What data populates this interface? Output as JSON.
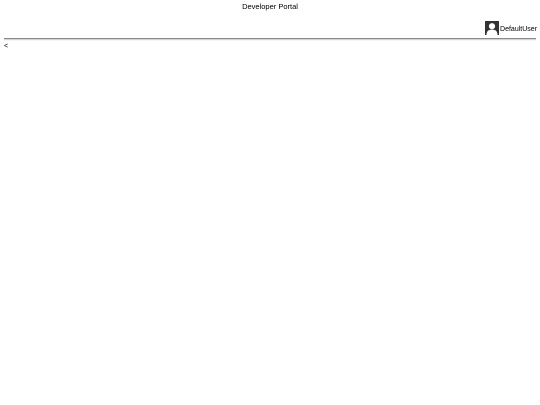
{
  "window": {
    "title": "Developer Portal"
  },
  "header": {
    "user": {
      "name": "DefaultUser",
      "avatar_icon": "user-avatar-icon"
    }
  },
  "nav": {
    "back_label": "<"
  },
  "colors": {
    "background": "#ffffff",
    "text": "#000000",
    "divider": "#8a8a8a",
    "avatar": "#333333"
  }
}
